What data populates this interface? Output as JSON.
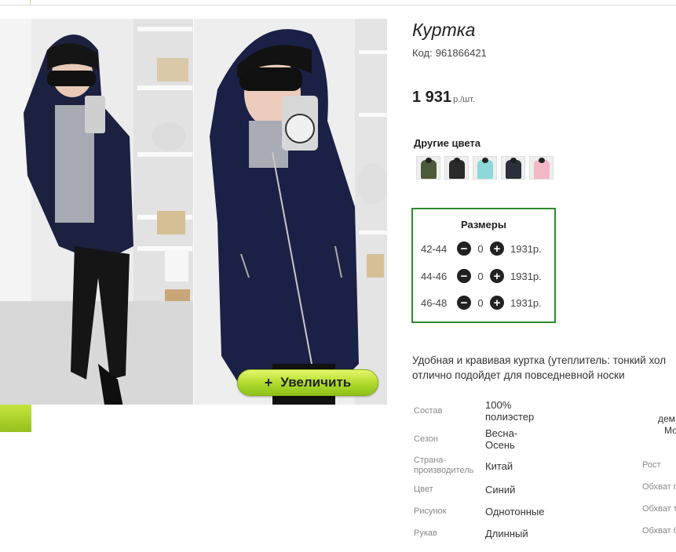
{
  "product": {
    "title": "Куртка",
    "code_label": "Код:",
    "code_value": "961866421",
    "price_value": "1 931",
    "price_unit": "р./шт.",
    "zoom_label": "Увеличить",
    "zoom_icon": "+"
  },
  "colors": {
    "title": "Другие цвета",
    "swatches": [
      "#4a5a3a",
      "#2a2a2a",
      "#8fd8d8",
      "#2a2f3a",
      "#f2b8c6"
    ]
  },
  "sizes": {
    "title": "Размеры",
    "rows": [
      {
        "size": "42-44",
        "qty": "0",
        "price": "1931р."
      },
      {
        "size": "44-46",
        "qty": "0",
        "price": "1931р."
      },
      {
        "size": "46-48",
        "qty": "0",
        "price": "1931р."
      }
    ],
    "minus_icon": "−",
    "plus_icon": "+"
  },
  "description": {
    "line1": "Удобная и кравивая куртка (утеплитель: тонкий хол",
    "line2": "отлично подойдет для повседневной носки"
  },
  "specs": [
    {
      "label": "Состав",
      "value": "100% полиэстер"
    },
    {
      "label": "Сезон",
      "value": "Весна-Осень"
    },
    {
      "label": "Страна-производитель",
      "value": "Китай"
    },
    {
      "label": "Цвет",
      "value": "Синий"
    },
    {
      "label": "Рисунок",
      "value": "Однотонные"
    },
    {
      "label": "Рукав",
      "value": "Длинный"
    }
  ],
  "specs_right": {
    "v1": "дем",
    "v2": "Мо",
    "l1": "Рост",
    "l2": "Обхват г",
    "l3": "Обхват т",
    "l4": "Обхват б"
  }
}
